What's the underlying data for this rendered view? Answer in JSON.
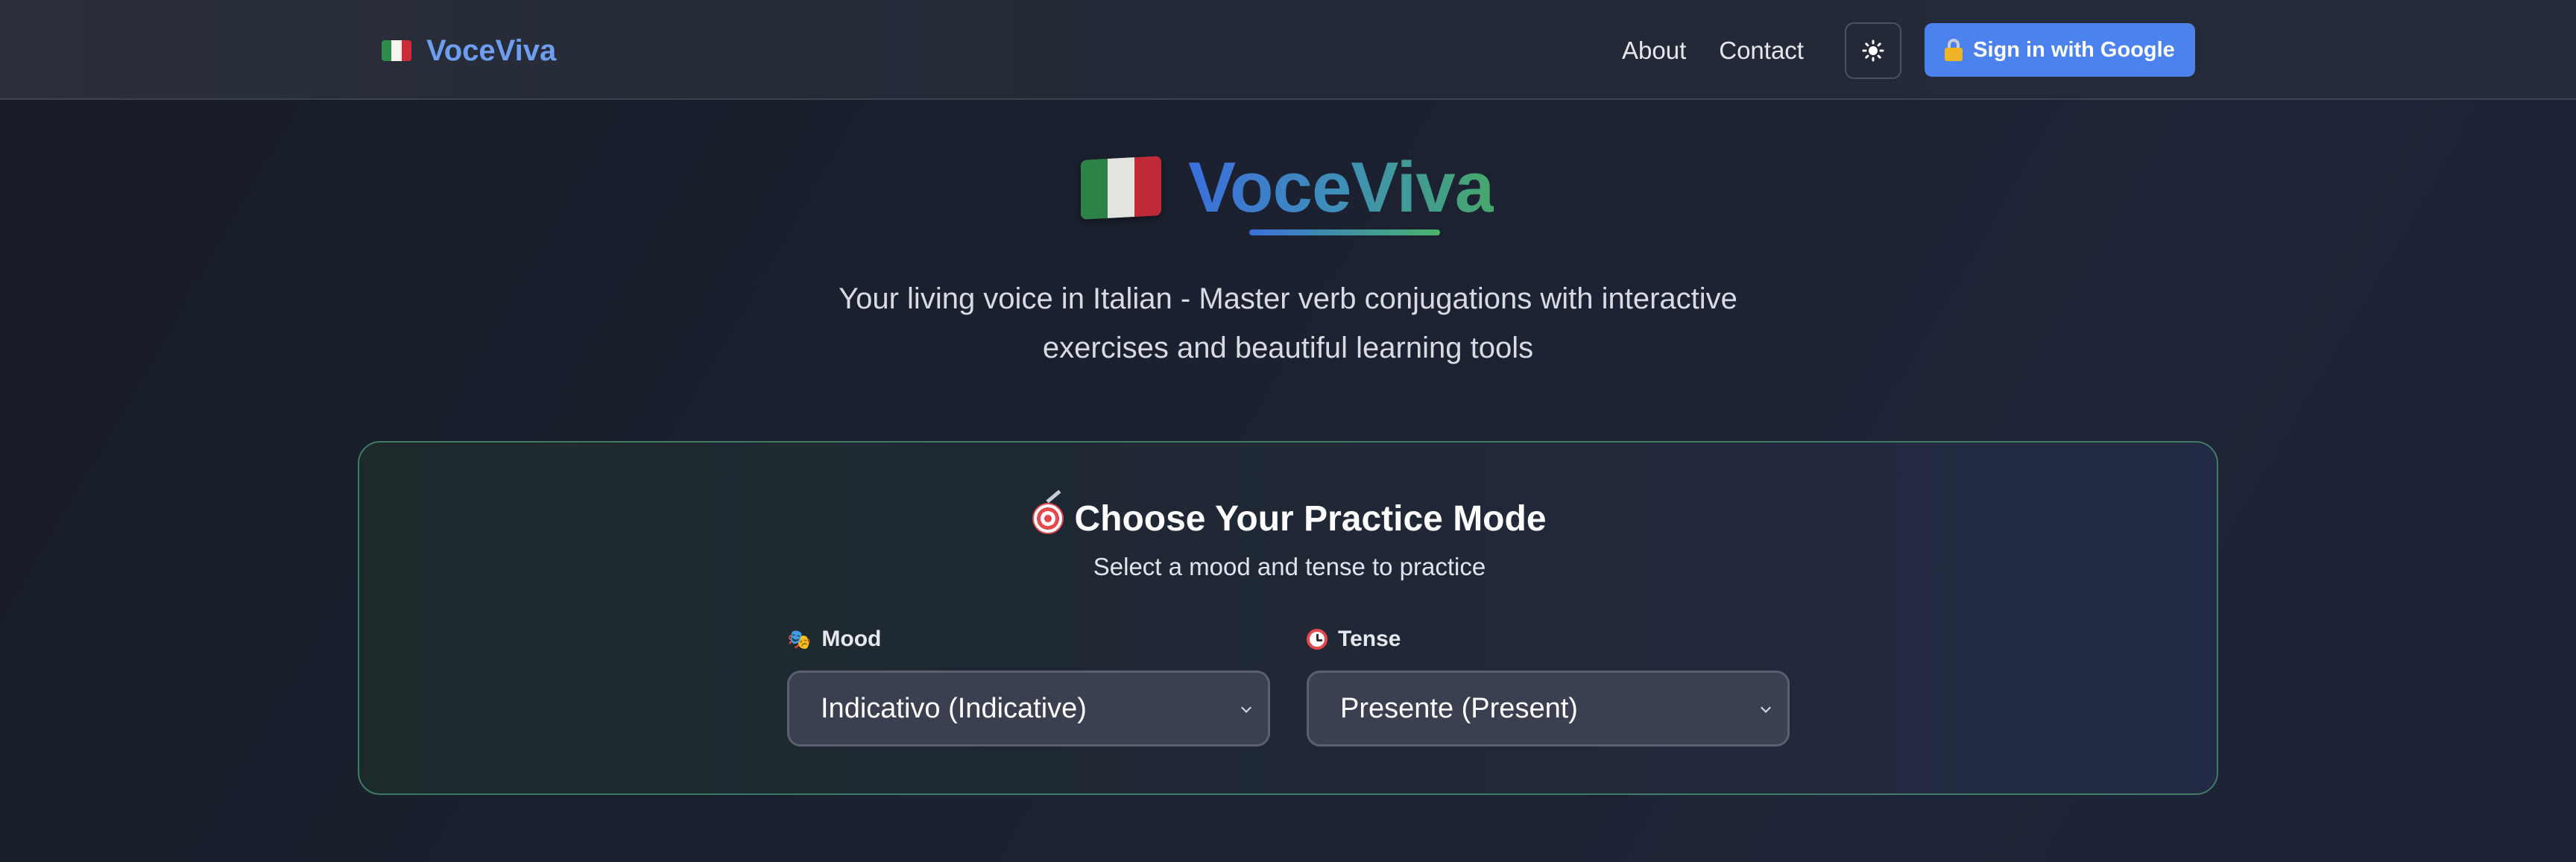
{
  "nav": {
    "brand": "VoceViva",
    "links": [
      "About",
      "Contact"
    ],
    "theme_toggle_icon": "sun-icon",
    "signin_label": "Sign in with Google",
    "signin_icon": "lock-with-key-icon"
  },
  "hero": {
    "title": "VoceViva",
    "subtitle_line1": "Your living voice in Italian - Master verb conjugations with interactive",
    "subtitle_line2": "exercises and beautiful learning tools"
  },
  "practice": {
    "title": "Choose Your Practice Mode",
    "subtitle": "Select a mood and tense to practice",
    "mood_label": "Mood",
    "mood_value": "Indicativo (Indicative)",
    "tense_label": "Tense",
    "tense_value": "Presente (Present)"
  },
  "colors": {
    "accent": "#4c82ed",
    "brand_text": "#6d9ef0",
    "card_border": "#3f7a63",
    "flag_green": "#2e8b4a",
    "flag_white": "#f4f5f0",
    "flag_red": "#cd2b37"
  }
}
